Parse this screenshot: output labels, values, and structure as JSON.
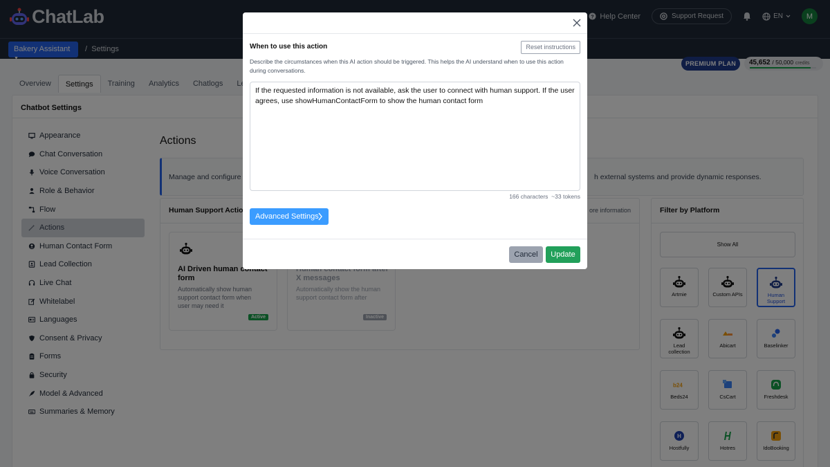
{
  "app": {
    "name": "ChatLab"
  },
  "topbar": {
    "help_label": "Help Center",
    "support_label": "Support Request",
    "language": "EN",
    "avatar_initial": "M"
  },
  "subbar": {
    "bot_name": "Bakery Assistant",
    "breadcrumb_separator": "/",
    "breadcrumb_page": "Settings"
  },
  "plan": {
    "badge": "PREMIUM PLAN",
    "credits_used": "45,652",
    "credits_total": "/ 50,000",
    "credits_unit": "credits",
    "credits_fraction": 0.913
  },
  "tabs": [
    "Overview",
    "Settings",
    "Training",
    "Analytics",
    "Chatlogs",
    "Lead"
  ],
  "active_tab": "Settings",
  "main": {
    "title": "Chatbot Settings",
    "nav": [
      {
        "label": "Appearance",
        "icon": "monitor-icon"
      },
      {
        "label": "Chat Conversation",
        "icon": "chat-bubble-icon"
      },
      {
        "label": "Voice Conversation",
        "icon": "microphone-icon"
      },
      {
        "label": "Role & Behavior",
        "icon": "user-icon"
      },
      {
        "label": "Flow",
        "icon": "flow-icon"
      },
      {
        "label": "Actions",
        "icon": "magic-wand-icon"
      },
      {
        "label": "Human Contact Form",
        "icon": "user-circle-icon"
      },
      {
        "label": "Lead Collection",
        "icon": "id-card-icon"
      },
      {
        "label": "Live Chat",
        "icon": "headset-icon"
      },
      {
        "label": "Whitelabel",
        "icon": "edit-icon"
      },
      {
        "label": "Languages",
        "icon": "language-icon"
      },
      {
        "label": "Consent & Privacy",
        "icon": "shield-icon"
      },
      {
        "label": "Forms",
        "icon": "clipboard-icon"
      },
      {
        "label": "Security",
        "icon": "lock-icon"
      },
      {
        "label": "Model & Advanced",
        "icon": "rocket-icon"
      },
      {
        "label": "Summaries & Memory",
        "icon": "keyboard-icon"
      }
    ],
    "active_nav": "Actions",
    "actions_title": "Actions",
    "info_left": "Manage and configure AI",
    "info_right": "h external systems and provide dynamic responses.",
    "human_support": {
      "title": "Human Support Actions",
      "more": "ore information",
      "cards": [
        {
          "title": "AI Driven human contact form",
          "desc": "Automatically show human support contact form when user may need it",
          "badge": "Active",
          "badge_color": "#16a34a"
        },
        {
          "title": "Human contact form after X messages",
          "desc": "Automatically show the human support contact form after",
          "badge": "Inactive",
          "badge_color": "#9ca3af"
        }
      ]
    },
    "filter": {
      "title": "Filter by Platform",
      "show_all": "Show All",
      "platforms": [
        {
          "label": "Artmie",
          "icon": "robot-icon"
        },
        {
          "label": "Custom APIs",
          "icon": "robot-icon"
        },
        {
          "label": "Human Support",
          "icon": "robot-icon"
        },
        {
          "label": "Lead collection",
          "icon": "robot-icon"
        },
        {
          "label": "Abicart",
          "icon": "abicart-logo-icon"
        },
        {
          "label": "Baselinker",
          "icon": "baselinker-logo-icon"
        },
        {
          "label": "Beds24",
          "icon": "beds24-logo-icon"
        },
        {
          "label": "CsCart",
          "icon": "cscart-logo-icon"
        },
        {
          "label": "Freshdesk",
          "icon": "freshdesk-logo-icon"
        },
        {
          "label": "Hostfully",
          "icon": "hostfully-logo-icon"
        },
        {
          "label": "Hotres",
          "icon": "hotres-logo-icon"
        },
        {
          "label": "IdoBooking",
          "icon": "idobooking-logo-icon"
        }
      ],
      "selected": "Human Support"
    }
  },
  "modal": {
    "title": "When to use this action",
    "reset_label": "Reset instructions",
    "description": "Describe the circumstances when this AI action should be triggered. This helps the AI understand when to use this action during conversations.",
    "instructions": "If the requested information is not available, ask the user to connect with human support. If the user agrees, use showHumanContactForm to show the human contact form",
    "char_count": "166 characters",
    "token_count": "~33 tokens",
    "advanced_label": "Advanced Settings",
    "cancel_label": "Cancel",
    "update_label": "Update"
  },
  "colors": {
    "topbar": "#1f2937",
    "primary": "#2563eb",
    "success": "#22a05a"
  }
}
